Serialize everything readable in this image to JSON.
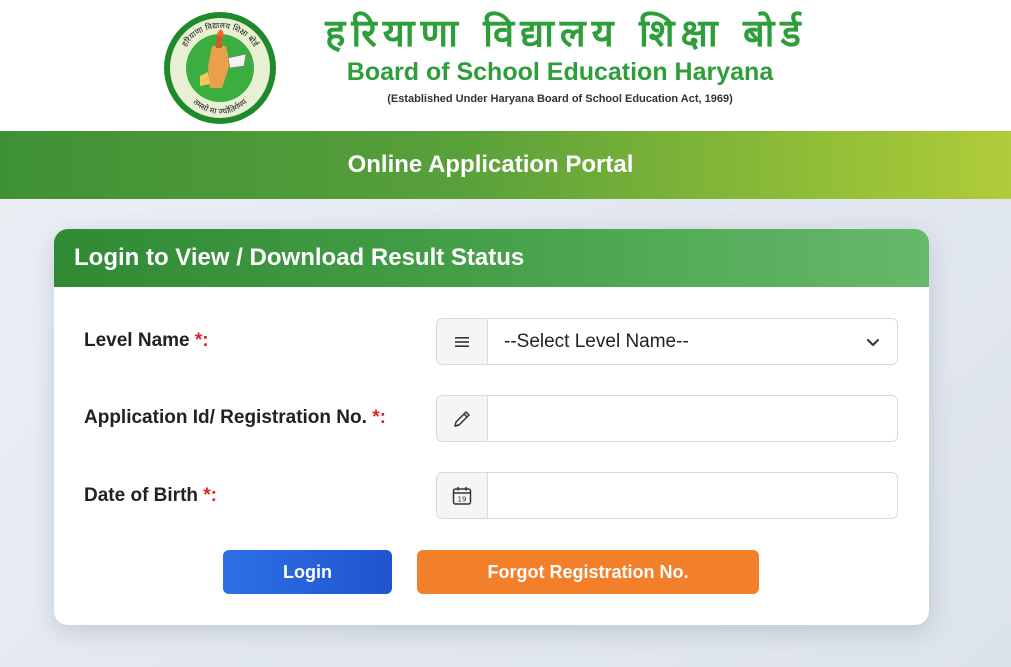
{
  "header": {
    "title_hindi": "हरियाणा विद्यालय शिक्षा बोर्ड",
    "title_english": "Board of School Education Haryana",
    "subtitle": "(Established Under Haryana Board of School Education Act, 1969)",
    "logo_text_top": "हरियाणा विद्यालय शिक्षा बोर्ड",
    "logo_text_bottom": "तमसो मा ज्योतिर्गमय"
  },
  "banner": {
    "title": "Online Application Portal"
  },
  "login_card": {
    "heading": "Login to View / Download Result Status",
    "fields": {
      "level": {
        "label": "Level Name ",
        "required": "*:",
        "selected": "--Select Level Name--",
        "icon": "list-icon"
      },
      "app_id": {
        "label": "Application Id/ Registration No. ",
        "required": "*:",
        "value": "",
        "placeholder": "",
        "icon": "pencil-icon"
      },
      "dob": {
        "label": "Date of Birth ",
        "required": "*:",
        "value": "",
        "placeholder": "",
        "icon": "calendar-icon",
        "calendar_day": "19"
      }
    },
    "buttons": {
      "login": "Login",
      "forgot": "Forgot Registration No."
    }
  },
  "colors": {
    "brand_green": "#2e9e3a",
    "login_blue": "#2d6fe6",
    "forgot_orange": "#f47f2a",
    "required_red": "#d9262a"
  }
}
